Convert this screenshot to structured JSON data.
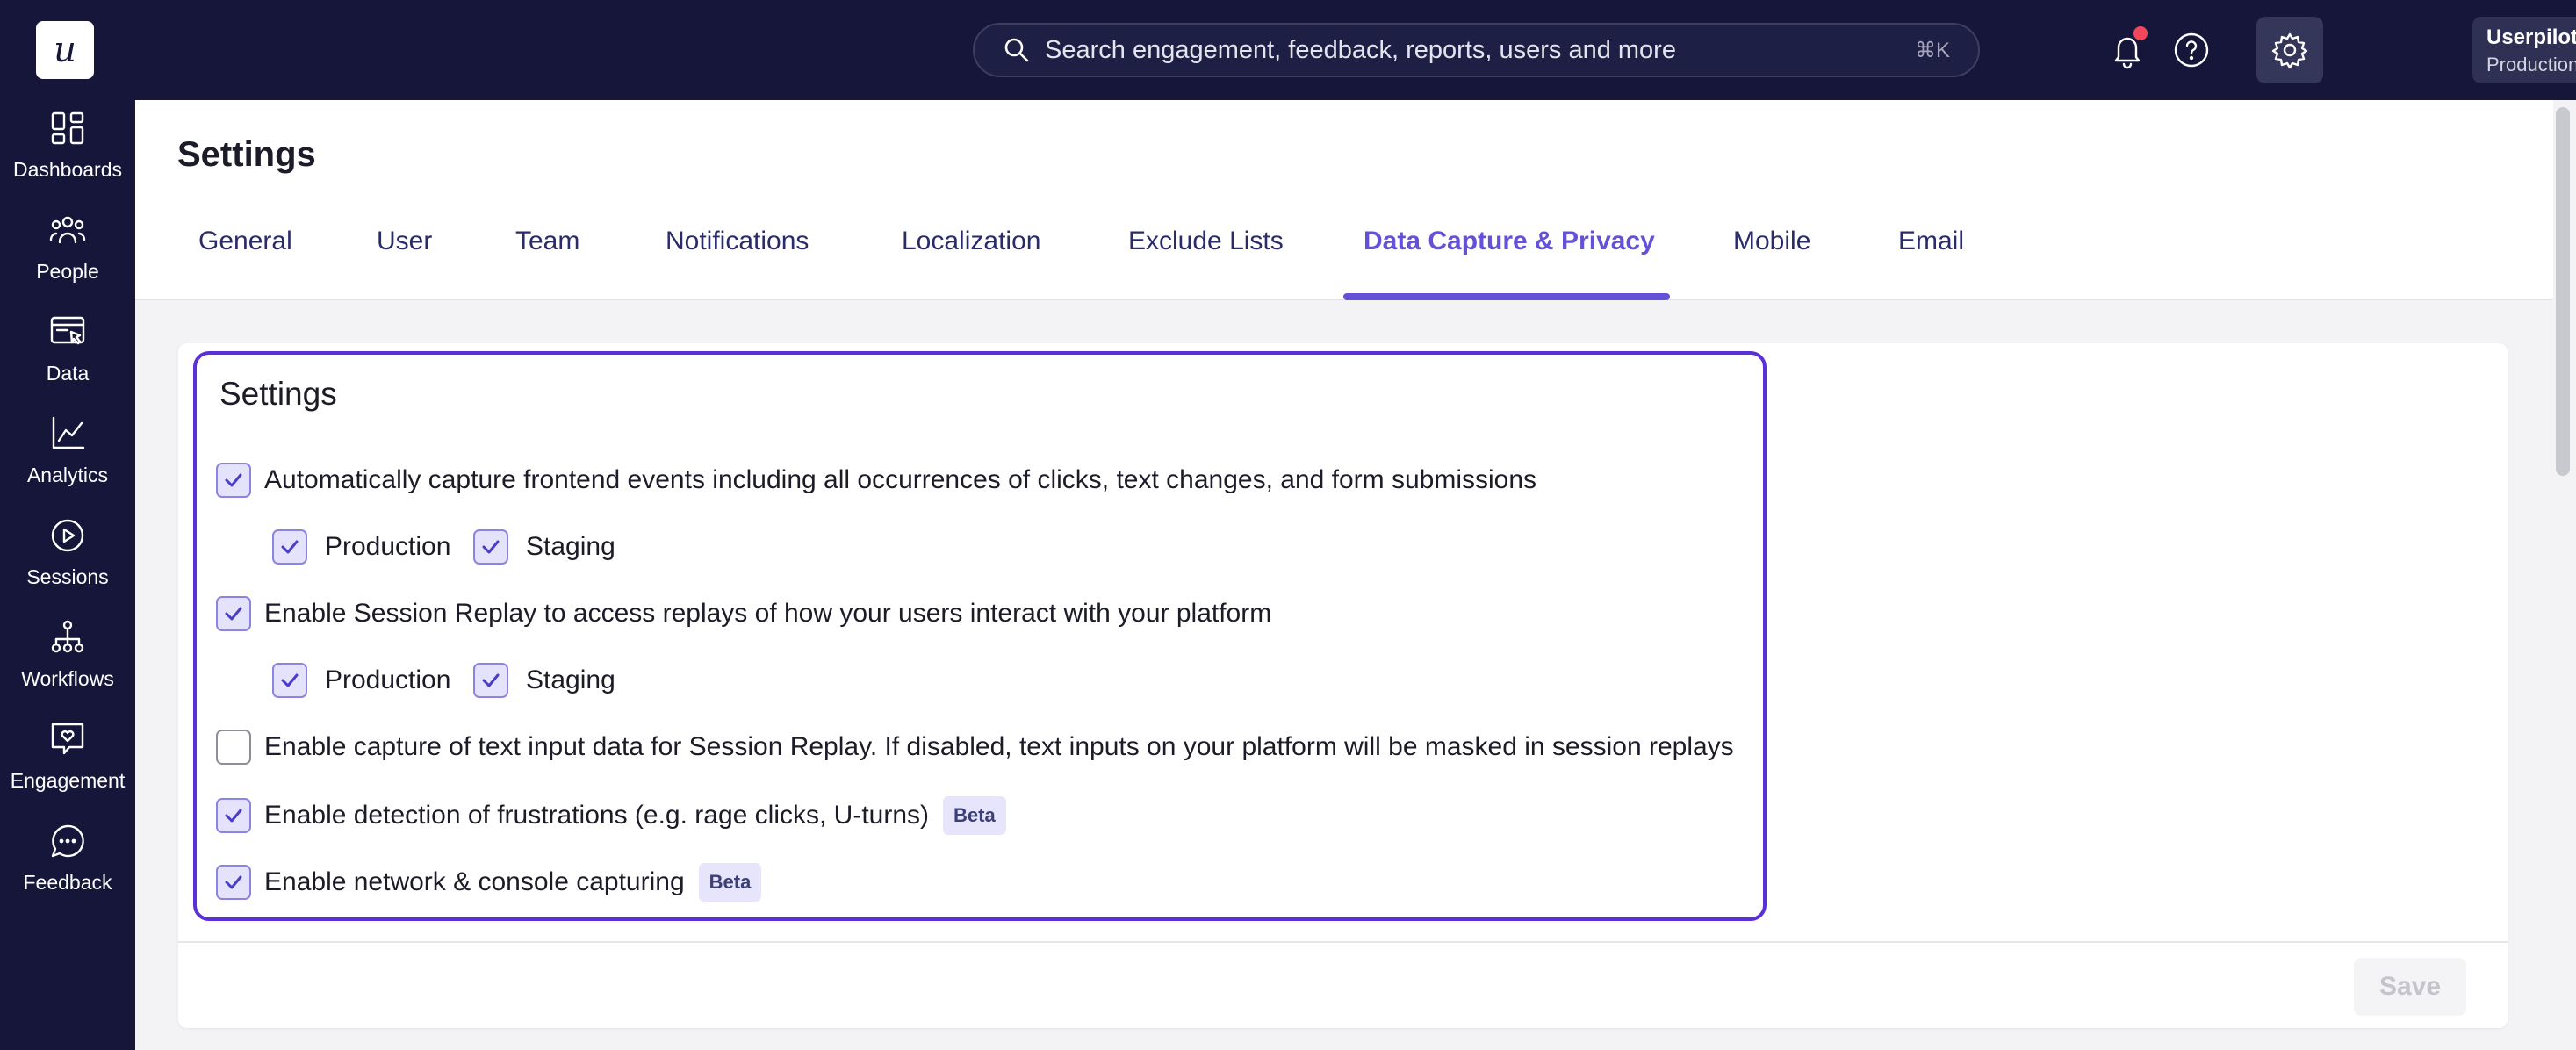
{
  "app": {
    "logo_letter": "u"
  },
  "sidebar": {
    "items": [
      {
        "label": "Dashboards",
        "icon": "dashboard-icon"
      },
      {
        "label": "People",
        "icon": "people-icon"
      },
      {
        "label": "Data",
        "icon": "data-icon"
      },
      {
        "label": "Analytics",
        "icon": "analytics-icon"
      },
      {
        "label": "Sessions",
        "icon": "sessions-icon"
      },
      {
        "label": "Workflows",
        "icon": "workflows-icon"
      },
      {
        "label": "Engagement",
        "icon": "engagement-icon"
      },
      {
        "label": "Feedback",
        "icon": "feedback-icon"
      }
    ]
  },
  "topbar": {
    "search_placeholder": "Search engagement, feedback, reports, users and more",
    "search_shortcut": "⌘K",
    "account_name": "Userpilot",
    "account_env": "Production",
    "notification_dot_color": "#f0485b"
  },
  "page": {
    "title": "Settings",
    "tabs": [
      {
        "label": "General",
        "active": false
      },
      {
        "label": "User",
        "active": false
      },
      {
        "label": "Team",
        "active": false
      },
      {
        "label": "Notifications",
        "active": false
      },
      {
        "label": "Localization",
        "active": false
      },
      {
        "label": "Exclude Lists",
        "active": false
      },
      {
        "label": "Data Capture & Privacy",
        "active": true
      },
      {
        "label": "Mobile",
        "active": false
      },
      {
        "label": "Email",
        "active": false
      }
    ],
    "accent_color": "#6352d8"
  },
  "settings": {
    "title": "Settings",
    "options": [
      {
        "label": "Automatically capture frontend events including all occurrences of clicks, text changes, and form submissions",
        "checked": true
      },
      {
        "label": "Production",
        "checked": true
      },
      {
        "label": "Staging",
        "checked": true
      },
      {
        "label": "Enable Session Replay to access replays of how your users interact with your platform",
        "checked": true
      },
      {
        "label": "Production",
        "checked": true
      },
      {
        "label": "Staging",
        "checked": true
      },
      {
        "label": "Enable capture of text input data for Session Replay. If disabled, text inputs on your platform will be masked in session replays",
        "checked": false
      },
      {
        "label": "Enable detection of frustrations (e.g. rage clicks, U-turns)",
        "checked": true,
        "badge": "Beta"
      },
      {
        "label": "Enable network & console capturing",
        "checked": true,
        "badge": "Beta"
      }
    ],
    "save_label": "Save"
  }
}
